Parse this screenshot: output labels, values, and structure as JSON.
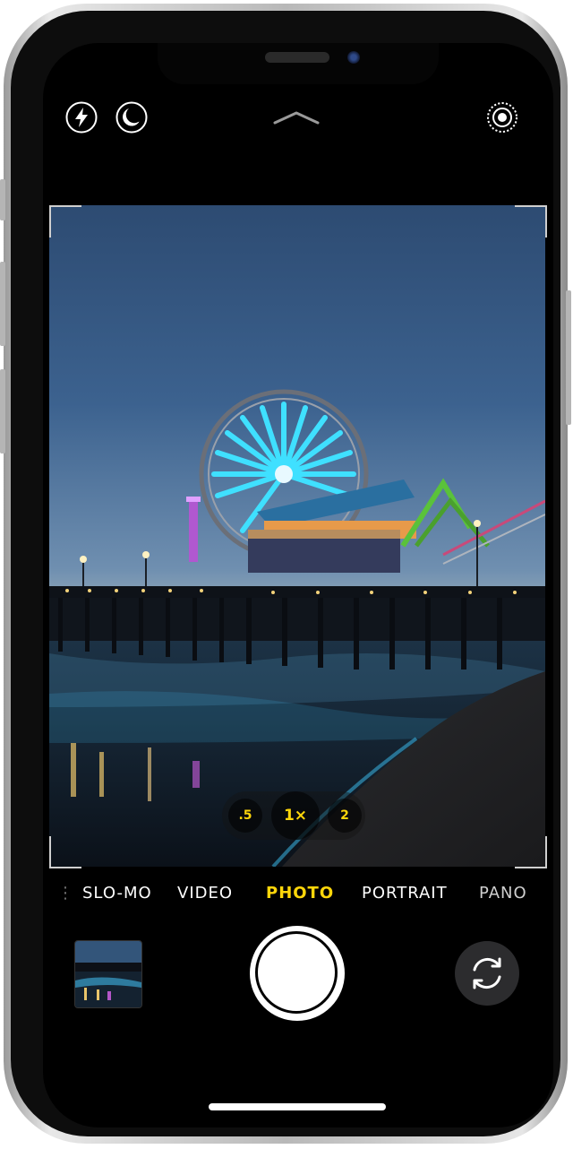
{
  "camera": {
    "top_bar": {
      "flash_icon": "flash-icon",
      "night_mode_icon": "night-mode-icon",
      "controls_chevron_icon": "chevron-up-icon",
      "live_photo_icon": "live-photo-icon"
    },
    "zoom": {
      "options": [
        ".5",
        "1×",
        "2"
      ],
      "selected": "1×"
    },
    "modes": {
      "items": [
        "SLO-MO",
        "VIDEO",
        "PHOTO",
        "PORTRAIT",
        "PANO"
      ],
      "active": "PHOTO"
    },
    "bottom": {
      "thumbnail_icon": "last-photo-thumbnail",
      "shutter_icon": "shutter-button",
      "flip_icon": "switch-camera-icon"
    },
    "colors": {
      "accent": "#ffd60a",
      "background": "#000000"
    }
  }
}
